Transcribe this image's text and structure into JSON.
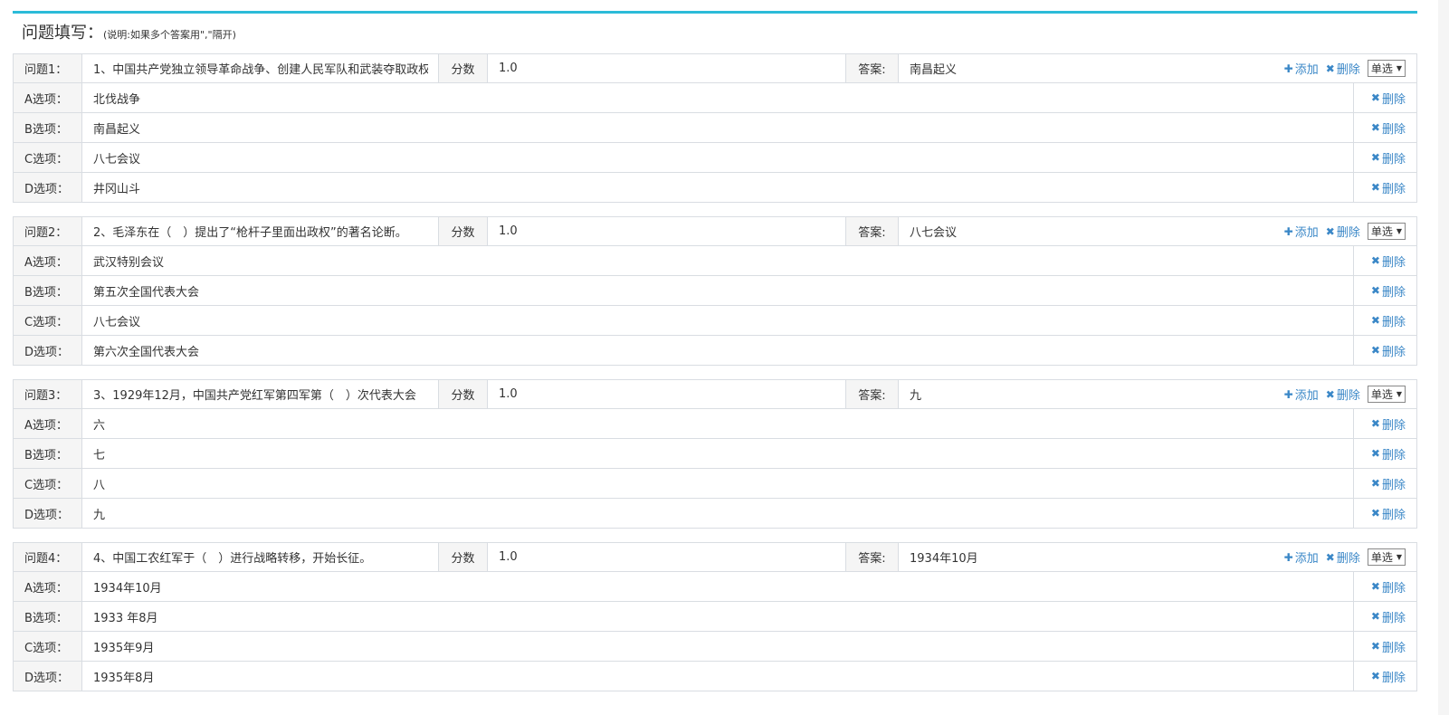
{
  "header": {
    "title": "问题填写：",
    "note": "(说明:如果多个答案用\",\"隔开)"
  },
  "labels": {
    "score": "分数",
    "answer": "答案:",
    "add": "添加",
    "delete": "删除",
    "option_suffix": "选项："
  },
  "questions": [
    {
      "label": "问题1：",
      "text": "1、中国共产党独立领导革命战争、创建人民军队和武装夺取政权",
      "score": "1.0",
      "answer": "南昌起义",
      "type": "单选",
      "options": [
        {
          "label": "A选项：",
          "value": "北伐战争"
        },
        {
          "label": "B选项：",
          "value": "南昌起义"
        },
        {
          "label": "C选项：",
          "value": "八七会议"
        },
        {
          "label": "D选项：",
          "value": "井冈山斗"
        }
      ]
    },
    {
      "label": "问题2：",
      "text": "2、毛泽东在（　）提出了“枪杆子里面出政权”的著名论断。",
      "score": "1.0",
      "answer": "八七会议",
      "type": "单选",
      "options": [
        {
          "label": "A选项：",
          "value": "武汉特别会议"
        },
        {
          "label": "B选项：",
          "value": "第五次全国代表大会"
        },
        {
          "label": "C选项：",
          "value": "八七会议"
        },
        {
          "label": "D选项：",
          "value": "第六次全国代表大会"
        }
      ]
    },
    {
      "label": "问题3：",
      "text": "3、1929年12月，中国共产党红军第四军第（　）次代表大会",
      "score": "1.0",
      "answer": "九",
      "type": "单选",
      "options": [
        {
          "label": "A选项：",
          "value": "六"
        },
        {
          "label": "B选项：",
          "value": "七"
        },
        {
          "label": "C选项：",
          "value": "八"
        },
        {
          "label": "D选项：",
          "value": "九"
        }
      ]
    },
    {
      "label": "问题4：",
      "text": "4、中国工农红军于（　）进行战略转移，开始长征。",
      "score": "1.0",
      "answer": "1934年10月",
      "type": "单选",
      "options": [
        {
          "label": "A选项：",
          "value": "1934年10月"
        },
        {
          "label": "B选项：",
          "value": "1933 年8月"
        },
        {
          "label": "C选项：",
          "value": "1935年9月"
        },
        {
          "label": "D选项：",
          "value": "1935年8月"
        }
      ]
    }
  ],
  "colors": {
    "accent_line": "#2bbbd8",
    "link": "#3a87c7",
    "border": "#d9dde2",
    "label_bg": "#f5f5f5"
  }
}
